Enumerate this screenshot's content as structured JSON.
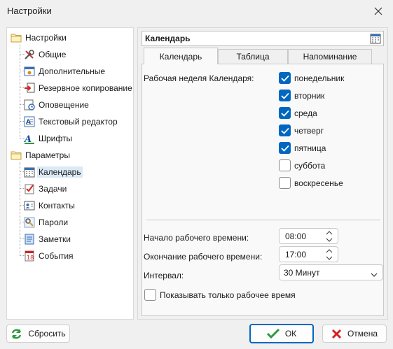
{
  "window": {
    "title": "Настройки"
  },
  "tree": {
    "root1": "Настройки",
    "root1_items": [
      "Общие",
      "Дополнительные",
      "Резервное копирование",
      "Оповещение",
      "Текстовый редактор",
      "Шрифты"
    ],
    "root2": "Параметры",
    "root2_items": [
      "Календарь",
      "Задачи",
      "Контакты",
      "Пароли",
      "Заметки",
      "События"
    ],
    "selected": "Календарь"
  },
  "panel": {
    "title": "Календарь",
    "tabs": [
      "Календарь",
      "Таблица",
      "Напоминание"
    ],
    "active_tab": "Календарь",
    "work_week_label": "Рабочая неделя Календаря:",
    "days": [
      {
        "label": "понедельник",
        "checked": true
      },
      {
        "label": "вторник",
        "checked": true
      },
      {
        "label": "среда",
        "checked": true
      },
      {
        "label": "четверг",
        "checked": true
      },
      {
        "label": "пятница",
        "checked": true
      },
      {
        "label": "суббота",
        "checked": false
      },
      {
        "label": "воскресенье",
        "checked": false
      }
    ],
    "start_label": "Начало рабочего времени:",
    "start_value": "08:00",
    "end_label": "Окончание рабочего времени:",
    "end_value": "17:00",
    "interval_label": "Интервал:",
    "interval_value": "30 Минут",
    "only_work_label": "Показывать только рабочее время",
    "only_work_checked": false
  },
  "buttons": {
    "reset": "Сбросить",
    "ok": "ОК",
    "cancel": "Отмена"
  },
  "colors": {
    "accent": "#0067c0",
    "background": "#f0f0f0",
    "selection": "#dbe9f7"
  }
}
